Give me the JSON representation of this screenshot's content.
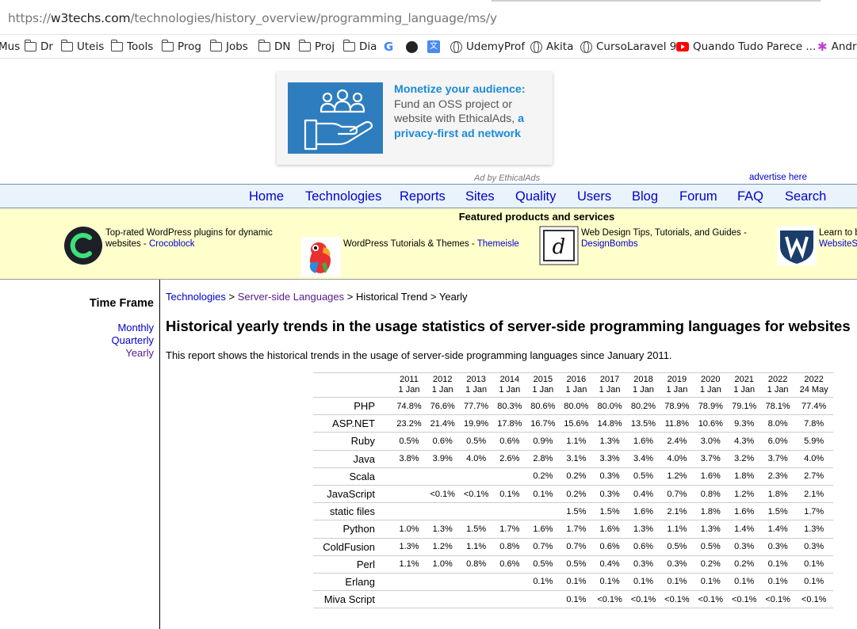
{
  "browser": {
    "url_prefix": "https://",
    "url_host": "w3techs.com",
    "url_path": "/technologies/history_overview/programming_language/ms/y",
    "bookmarks": [
      "Mus",
      "Dr",
      "Uteis",
      "Tools",
      "Prog",
      "Jobs",
      "DN",
      "Proj",
      "Dia",
      "",
      "",
      "",
      "UdemyProf",
      "Akita",
      "CursoLaravel 9",
      "Quando Tudo Parece ...",
      "Andr"
    ]
  },
  "ad": {
    "headline": "Monetize your audience:",
    "body": "Fund an OSS project or website with EthicalAds, ",
    "link": "a privacy-first ad network",
    "by": "Ad by EthicalAds",
    "advertise": "advertise here"
  },
  "nav": [
    "Home",
    "Technologies",
    "Reports",
    "Sites",
    "Quality",
    "Users",
    "Blog",
    "Forum",
    "FAQ",
    "Search"
  ],
  "featured": {
    "title": "Featured products and services",
    "items": [
      {
        "text": "Top-rated WordPress plugins for dynamic websites - ",
        "link": "Crocoblock"
      },
      {
        "text": "WordPress Tutorials & Themes - ",
        "link": "Themeisle"
      },
      {
        "text": "Web Design Tips, Tutorials, and Guides - ",
        "link": "DesignBombs"
      },
      {
        "text": "Learn to b",
        "link": "WebsiteS"
      }
    ]
  },
  "timeframe": {
    "title": "Time Frame",
    "options": [
      "Monthly",
      "Quarterly",
      "Yearly"
    ]
  },
  "breadcrumb": {
    "technologies": "Technologies",
    "sep": " > ",
    "category": "Server-side Languages",
    "trend": "Historical Trend",
    "current": "Yearly"
  },
  "page": {
    "title": "Historical yearly trends in the usage statistics of server-side programming languages for websites",
    "intro": "This report shows the historical trends in the usage of server-side programming languages since January 2011."
  },
  "table": {
    "columns": [
      {
        "year": "2011",
        "date": "1 Jan"
      },
      {
        "year": "2012",
        "date": "1 Jan"
      },
      {
        "year": "2013",
        "date": "1 Jan"
      },
      {
        "year": "2014",
        "date": "1 Jan"
      },
      {
        "year": "2015",
        "date": "1 Jan"
      },
      {
        "year": "2016",
        "date": "1 Jan"
      },
      {
        "year": "2017",
        "date": "1 Jan"
      },
      {
        "year": "2018",
        "date": "1 Jan"
      },
      {
        "year": "2019",
        "date": "1 Jan"
      },
      {
        "year": "2020",
        "date": "1 Jan"
      },
      {
        "year": "2021",
        "date": "1 Jan"
      },
      {
        "year": "2022",
        "date": "1 Jan"
      },
      {
        "year": "2022",
        "date": "24 May"
      }
    ],
    "rows": [
      {
        "name": "PHP",
        "values": [
          "74.8%",
          "76.6%",
          "77.7%",
          "80.3%",
          "80.6%",
          "80.0%",
          "80.0%",
          "80.2%",
          "78.9%",
          "78.9%",
          "79.1%",
          "78.1%",
          "77.4%"
        ]
      },
      {
        "name": "ASP.NET",
        "values": [
          "23.2%",
          "21.4%",
          "19.9%",
          "17.8%",
          "16.7%",
          "15.6%",
          "14.8%",
          "13.5%",
          "11.8%",
          "10.6%",
          "9.3%",
          "8.0%",
          "7.8%"
        ]
      },
      {
        "name": "Ruby",
        "values": [
          "0.5%",
          "0.6%",
          "0.5%",
          "0.6%",
          "0.9%",
          "1.1%",
          "1.3%",
          "1.6%",
          "2.4%",
          "3.0%",
          "4.3%",
          "6.0%",
          "5.9%"
        ]
      },
      {
        "name": "Java",
        "values": [
          "3.8%",
          "3.9%",
          "4.0%",
          "2.6%",
          "2.8%",
          "3.1%",
          "3.3%",
          "3.4%",
          "4.0%",
          "3.7%",
          "3.2%",
          "3.7%",
          "4.0%"
        ]
      },
      {
        "name": "Scala",
        "values": [
          "",
          "",
          "",
          "",
          "0.2%",
          "0.2%",
          "0.3%",
          "0.5%",
          "1.2%",
          "1.6%",
          "1.8%",
          "2.3%",
          "2.7%"
        ]
      },
      {
        "name": "JavaScript",
        "values": [
          "",
          "<0.1%",
          "<0.1%",
          "0.1%",
          "0.1%",
          "0.2%",
          "0.3%",
          "0.4%",
          "0.7%",
          "0.8%",
          "1.2%",
          "1.8%",
          "2.1%"
        ]
      },
      {
        "name": "static files",
        "values": [
          "",
          "",
          "",
          "",
          "",
          "1.5%",
          "1.5%",
          "1.6%",
          "2.1%",
          "1.8%",
          "1.6%",
          "1.5%",
          "1.7%"
        ]
      },
      {
        "name": "Python",
        "values": [
          "1.0%",
          "1.3%",
          "1.5%",
          "1.7%",
          "1.6%",
          "1.7%",
          "1.6%",
          "1.3%",
          "1.1%",
          "1.3%",
          "1.4%",
          "1.4%",
          "1.3%"
        ]
      },
      {
        "name": "ColdFusion",
        "values": [
          "1.3%",
          "1.2%",
          "1.1%",
          "0.8%",
          "0.7%",
          "0.7%",
          "0.6%",
          "0.6%",
          "0.5%",
          "0.5%",
          "0.3%",
          "0.3%",
          "0.3%"
        ]
      },
      {
        "name": "Perl",
        "values": [
          "1.1%",
          "1.0%",
          "0.8%",
          "0.6%",
          "0.5%",
          "0.5%",
          "0.4%",
          "0.3%",
          "0.3%",
          "0.2%",
          "0.2%",
          "0.1%",
          "0.1%"
        ]
      },
      {
        "name": "Erlang",
        "values": [
          "",
          "",
          "",
          "",
          "0.1%",
          "0.1%",
          "0.1%",
          "0.1%",
          "0.1%",
          "0.1%",
          "0.1%",
          "0.1%",
          "0.1%"
        ]
      },
      {
        "name": "Miva Script",
        "values": [
          "",
          "",
          "",
          "",
          "",
          "0.1%",
          "<0.1%",
          "<0.1%",
          "<0.1%",
          "<0.1%",
          "<0.1%",
          "<0.1%",
          "<0.1%"
        ]
      }
    ]
  }
}
